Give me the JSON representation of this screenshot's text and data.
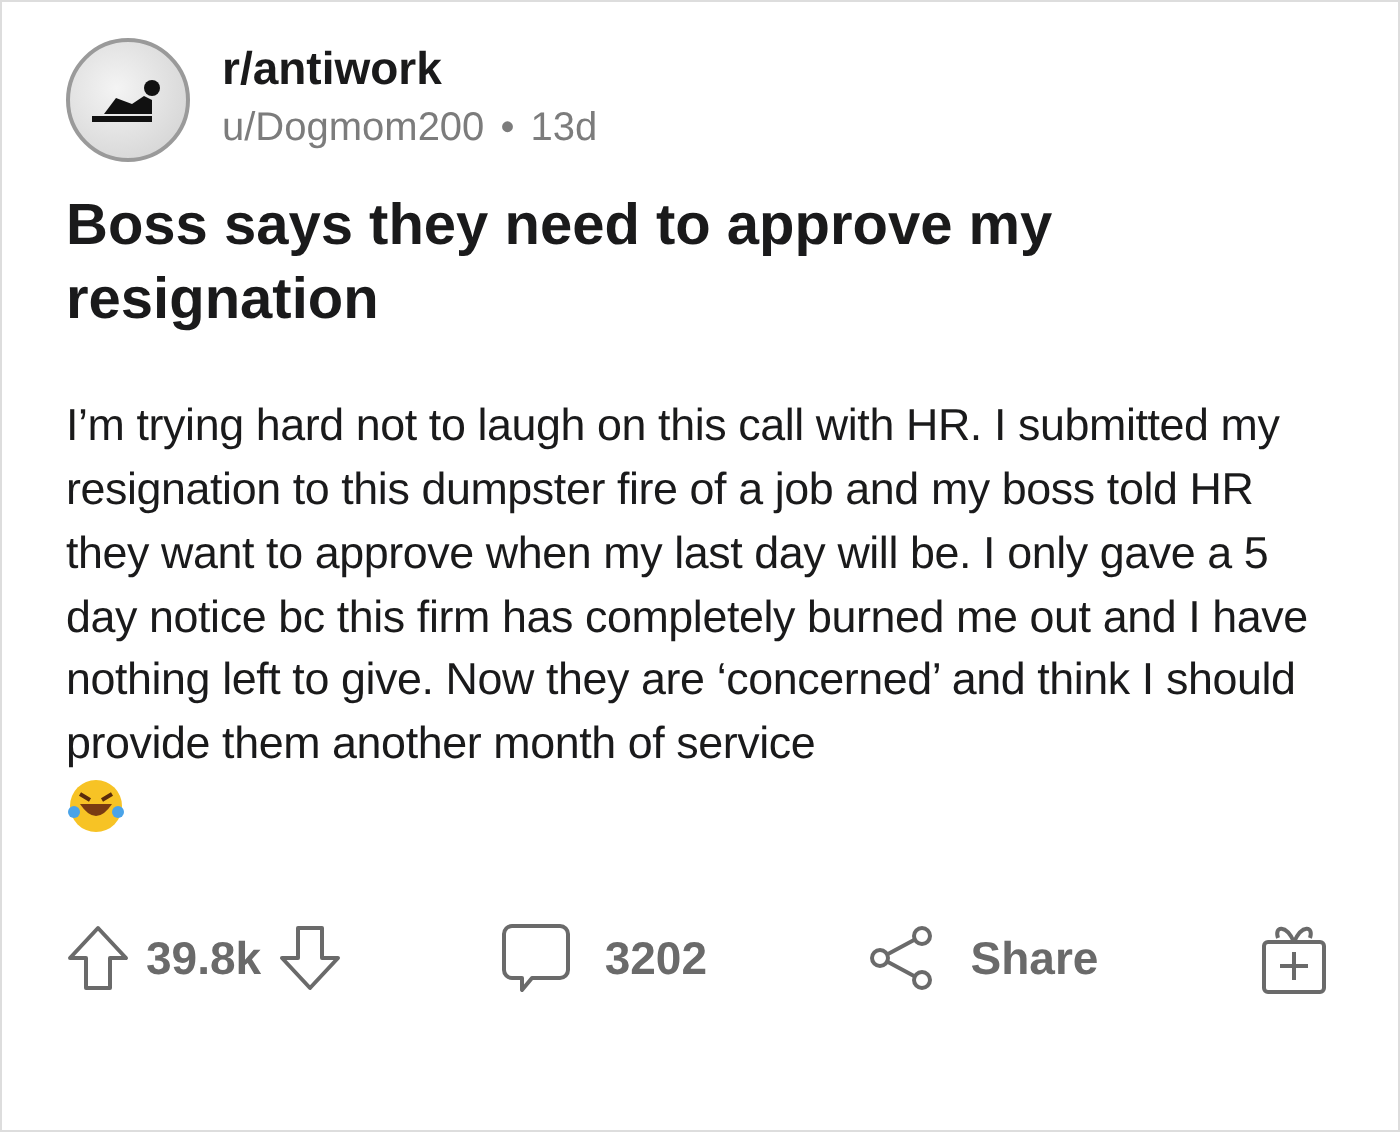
{
  "post": {
    "subreddit": "r/antiwork",
    "author": "u/Dogmom200",
    "separator": "•",
    "age": "13d",
    "title": "Boss says they need to approve my resignation",
    "body": "I’m trying hard not to laugh on this call with HR. I submitted my resignation to this dumpster fire of a job and my boss told HR they want to approve when my last day will be. I only gave a 5 day notice bc this firm has completely burned me out and I have nothing left to give. Now they are ‘concerned’ and think I should provide them another month of service"
  },
  "actions": {
    "votes": "39.8k",
    "comments": "3202",
    "share": "Share"
  }
}
